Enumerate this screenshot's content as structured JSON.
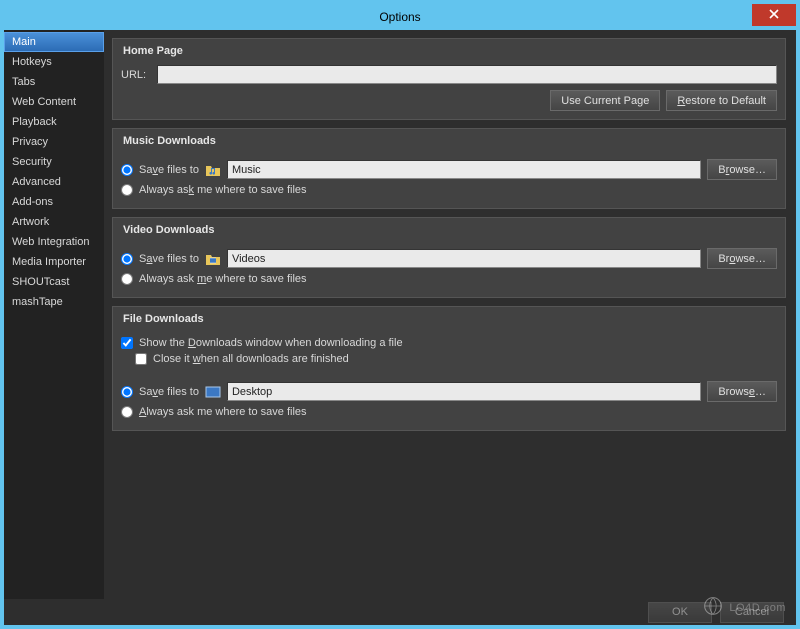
{
  "window": {
    "title": "Options"
  },
  "sidebar": {
    "items": [
      {
        "label": "Main",
        "selected": true
      },
      {
        "label": "Hotkeys"
      },
      {
        "label": "Tabs"
      },
      {
        "label": "Web Content"
      },
      {
        "label": "Playback"
      },
      {
        "label": "Privacy"
      },
      {
        "label": "Security"
      },
      {
        "label": "Advanced"
      },
      {
        "label": "Add-ons"
      },
      {
        "label": "Artwork"
      },
      {
        "label": "Web Integration"
      },
      {
        "label": "Media Importer"
      },
      {
        "label": "SHOUTcast"
      },
      {
        "label": "mashTape"
      }
    ]
  },
  "sections": {
    "home": {
      "title": "Home Page",
      "url_label": "URL:",
      "url_value": "",
      "use_current": "Use Current Page",
      "restore": "Restore to Default"
    },
    "music": {
      "title": "Music Downloads",
      "save_label_pre": "Sa",
      "save_label_ul": "v",
      "save_label_post": "e files to",
      "path": "Music",
      "browse_pre": "B",
      "browse_ul": "r",
      "browse_post": "owse…",
      "ask_pre": "Always as",
      "ask_ul": "k",
      "ask_post": " me where to save files"
    },
    "video": {
      "title": "Video Downloads",
      "save_label_pre": "S",
      "save_label_ul": "a",
      "save_label_post": "ve files to",
      "path": "Videos",
      "browse_pre": "Br",
      "browse_ul": "o",
      "browse_post": "wse…",
      "ask_pre": "Always ask ",
      "ask_ul": "m",
      "ask_post": "e where to save files"
    },
    "file": {
      "title": "File Downloads",
      "show_pre": "Show the ",
      "show_ul": "D",
      "show_post": "ownloads window when downloading a file",
      "close_pre": "Close it ",
      "close_ul": "w",
      "close_post": "hen all downloads are finished",
      "save_label_pre": "Sa",
      "save_label_ul": "v",
      "save_label_post": "e files to",
      "path": "Desktop",
      "browse_pre": "Brows",
      "browse_ul": "e",
      "browse_post": "…",
      "ask_pre": "",
      "ask_ul": "A",
      "ask_post": "lways ask me where to save files"
    }
  },
  "footer": {
    "ok": "OK",
    "cancel": "Cancel"
  },
  "watermark": "LO4D.com"
}
